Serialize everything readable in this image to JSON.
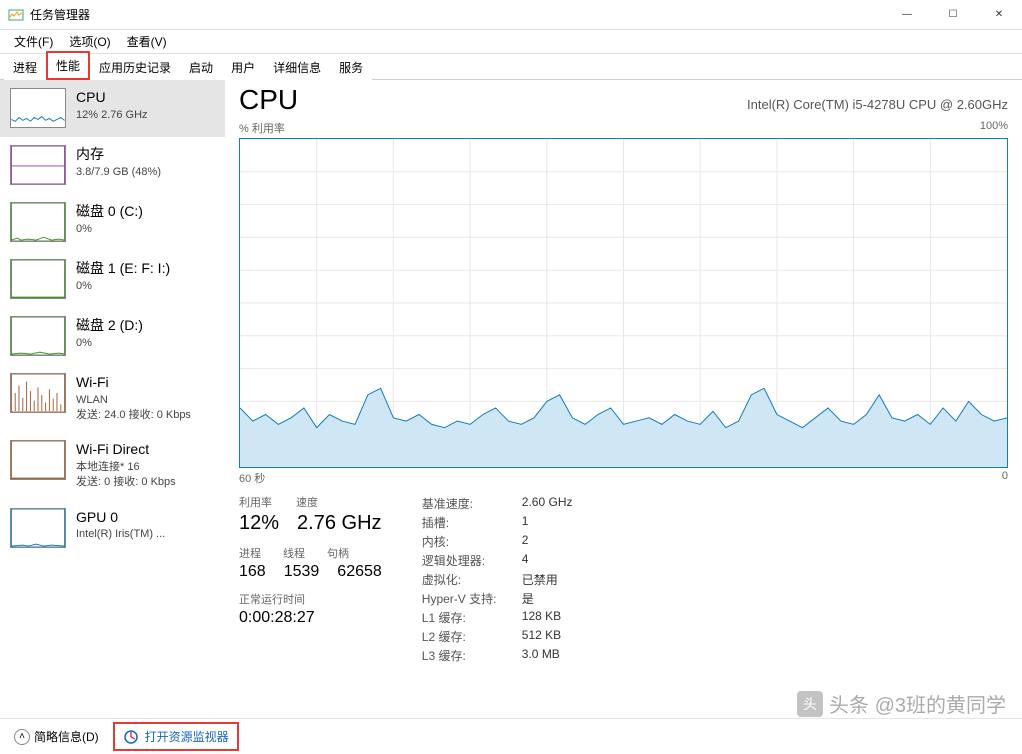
{
  "window": {
    "title": "任务管理器"
  },
  "menu": {
    "file": "文件(F)",
    "options": "选项(O)",
    "view": "查看(V)"
  },
  "tabs": {
    "processes": "进程",
    "performance": "性能",
    "app_history": "应用历史记录",
    "startup": "启动",
    "users": "用户",
    "details": "详细信息",
    "services": "服务"
  },
  "sidebar": [
    {
      "title": "CPU",
      "sub": "12% 2.76 GHz",
      "color": "#117dbb"
    },
    {
      "title": "内存",
      "sub": "3.8/7.9 GB (48%)",
      "color": "#9b2fae"
    },
    {
      "title": "磁盘 0 (C:)",
      "sub": "0%",
      "color": "#3f8f29"
    },
    {
      "title": "磁盘 1 (E: F: I:)",
      "sub": "0%",
      "color": "#3f8f29"
    },
    {
      "title": "磁盘 2 (D:)",
      "sub": "0%",
      "color": "#3f8f29"
    },
    {
      "title": "Wi-Fi",
      "sub": "WLAN",
      "sub2": "发送: 24.0 接收: 0 Kbps",
      "color": "#a15c2f"
    },
    {
      "title": "Wi-Fi Direct",
      "sub": "本地连接* 16",
      "sub2": "发送: 0 接收: 0 Kbps",
      "color": "#a15c2f"
    },
    {
      "title": "GPU 0",
      "sub": "Intel(R) Iris(TM) ...",
      "color": "#117dbb"
    }
  ],
  "main": {
    "title": "CPU",
    "model": "Intel(R) Core(TM) i5-4278U CPU @ 2.60GHz",
    "ylabel": "% 利用率",
    "ymax": "100%",
    "xleft": "60 秒",
    "xright": "0",
    "stats": {
      "util_lbl": "利用率",
      "util_val": "12%",
      "speed_lbl": "速度",
      "speed_val": "2.76 GHz",
      "proc_lbl": "进程",
      "proc_val": "168",
      "threads_lbl": "线程",
      "threads_val": "1539",
      "handles_lbl": "句柄",
      "handles_val": "62658",
      "uptime_lbl": "正常运行时间",
      "uptime_val": "0:00:28:27"
    },
    "details": [
      {
        "k": "基准速度:",
        "v": "2.60 GHz"
      },
      {
        "k": "插槽:",
        "v": "1"
      },
      {
        "k": "内核:",
        "v": "2"
      },
      {
        "k": "逻辑处理器:",
        "v": "4"
      },
      {
        "k": "虚拟化:",
        "v": "已禁用"
      },
      {
        "k": "Hyper-V 支持:",
        "v": "是"
      },
      {
        "k": "L1 缓存:",
        "v": "128 KB"
      },
      {
        "k": "L2 缓存:",
        "v": "512 KB"
      },
      {
        "k": "L3 缓存:",
        "v": "3.0 MB"
      }
    ]
  },
  "footer": {
    "brief": "简略信息(D)",
    "resmon": "打开资源监视器"
  },
  "watermark": "头条 @3班的黄同学",
  "chart_data": {
    "type": "area",
    "title": "% 利用率",
    "xlabel": "60 秒 → 0",
    "ylabel": "% 利用率",
    "ylim": [
      0,
      100
    ],
    "x": [
      0,
      1,
      2,
      3,
      4,
      5,
      6,
      7,
      8,
      9,
      10,
      11,
      12,
      13,
      14,
      15,
      16,
      17,
      18,
      19,
      20,
      21,
      22,
      23,
      24,
      25,
      26,
      27,
      28,
      29,
      30,
      31,
      32,
      33,
      34,
      35,
      36,
      37,
      38,
      39,
      40,
      41,
      42,
      43,
      44,
      45,
      46,
      47,
      48,
      49,
      50,
      51,
      52,
      53,
      54,
      55,
      56,
      57,
      58,
      59,
      60
    ],
    "values": [
      18,
      14,
      16,
      13,
      15,
      18,
      12,
      16,
      14,
      13,
      22,
      24,
      15,
      14,
      16,
      13,
      12,
      14,
      13,
      16,
      18,
      14,
      13,
      15,
      20,
      22,
      15,
      13,
      16,
      18,
      13,
      14,
      15,
      13,
      16,
      14,
      13,
      17,
      12,
      14,
      22,
      24,
      16,
      14,
      12,
      15,
      18,
      14,
      13,
      16,
      22,
      15,
      14,
      16,
      13,
      18,
      14,
      20,
      16,
      14,
      15
    ]
  }
}
